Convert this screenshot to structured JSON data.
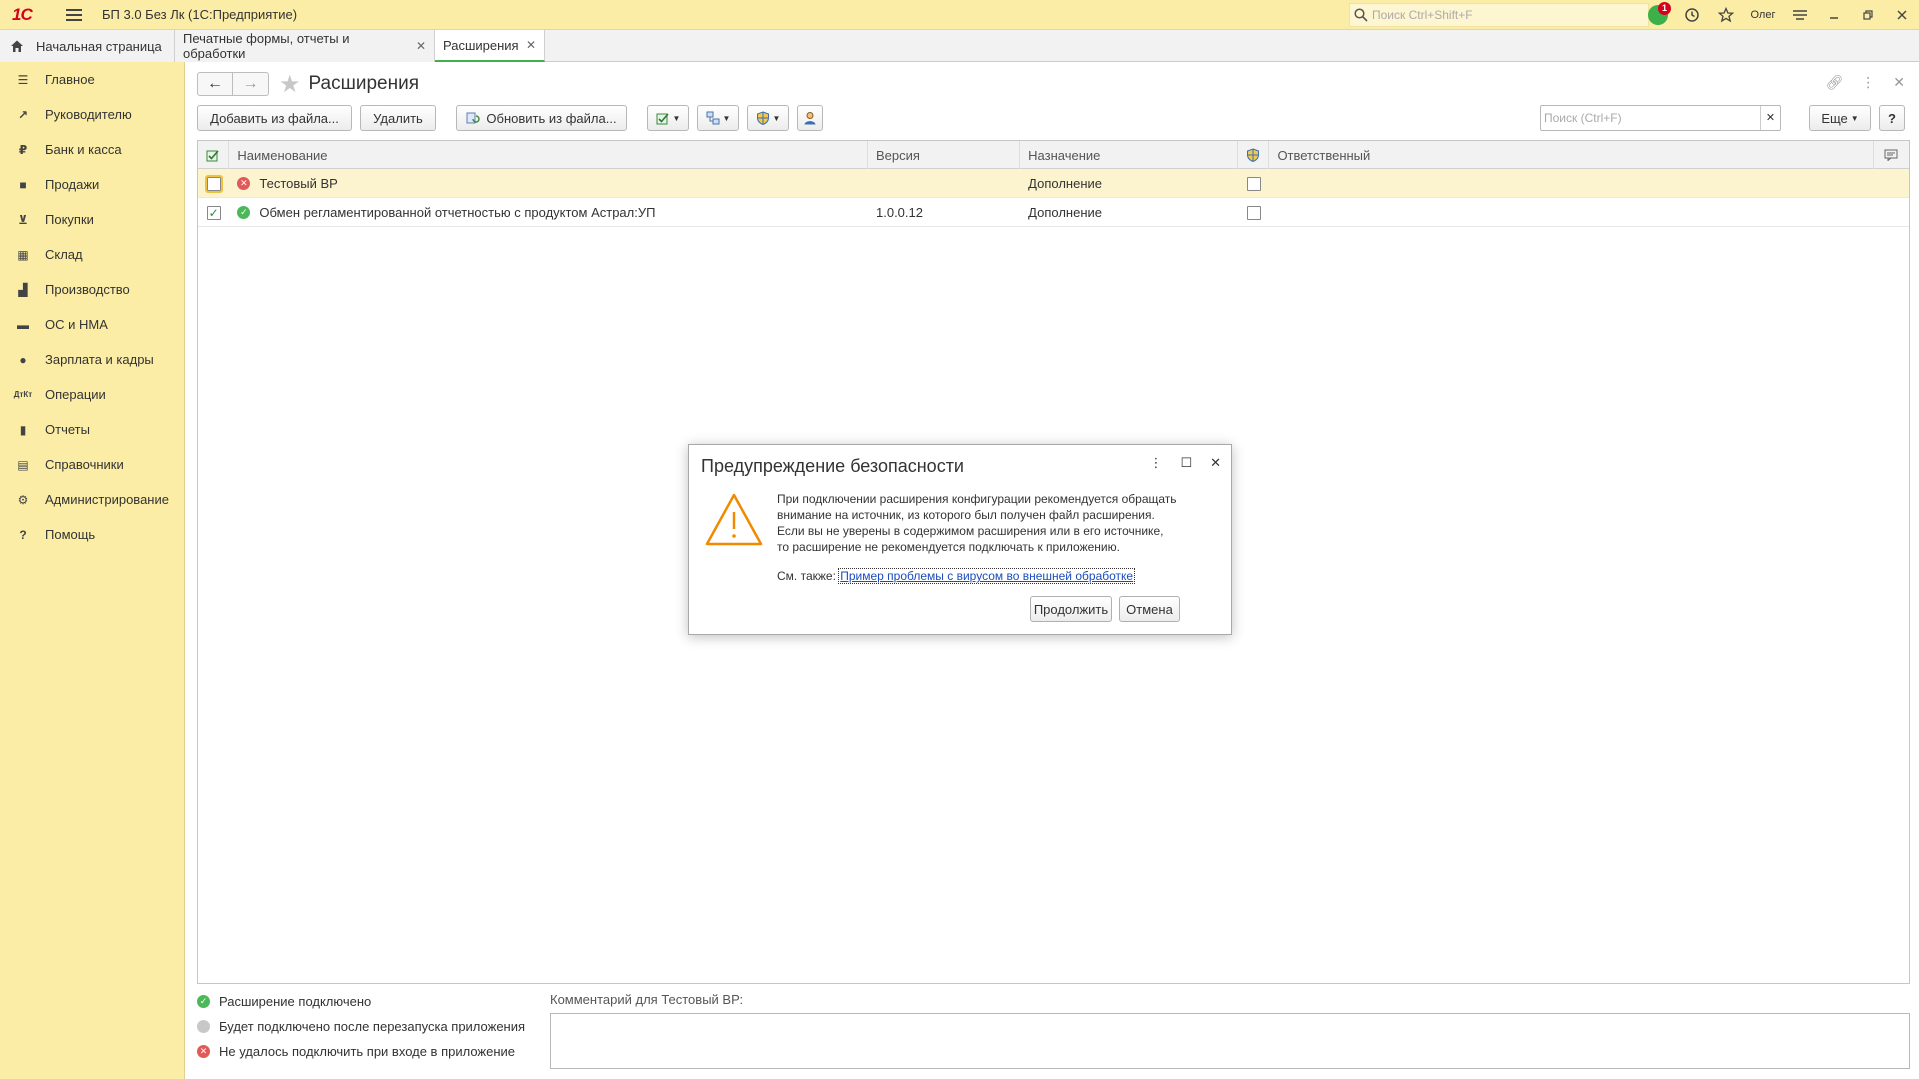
{
  "app": {
    "title": "БП 3.0 Без Лк  (1С:Предприятие)",
    "search_placeholder": "Поиск Ctrl+Shift+F",
    "notifications_count": "1",
    "user": "Олег"
  },
  "tabs": [
    {
      "label": "Начальная страница"
    },
    {
      "label": "Печатные формы, отчеты и обработки"
    },
    {
      "label": "Расширения"
    }
  ],
  "sidebar": {
    "items": [
      {
        "label": "Главное",
        "icon": "menu-icon"
      },
      {
        "label": "Руководителю",
        "icon": "trend-icon"
      },
      {
        "label": "Банк и касса",
        "icon": "ruble-icon"
      },
      {
        "label": "Продажи",
        "icon": "bag-icon"
      },
      {
        "label": "Покупки",
        "icon": "cart-icon"
      },
      {
        "label": "Склад",
        "icon": "grid-icon"
      },
      {
        "label": "Производство",
        "icon": "factory-icon"
      },
      {
        "label": "ОС и НМА",
        "icon": "truck-icon"
      },
      {
        "label": "Зарплата и кадры",
        "icon": "person-icon"
      },
      {
        "label": "Операции",
        "icon": "dt-kt-icon"
      },
      {
        "label": "Отчеты",
        "icon": "bar-chart-icon"
      },
      {
        "label": "Справочники",
        "icon": "book-icon"
      },
      {
        "label": "Администрирование",
        "icon": "gear-icon"
      },
      {
        "label": "Помощь",
        "icon": "question-icon"
      }
    ]
  },
  "page": {
    "title": "Расширения"
  },
  "toolbar": {
    "add_label": "Добавить из файла...",
    "delete_label": "Удалить",
    "update_label": "Обновить из файла...",
    "search_placeholder": "Поиск (Ctrl+F)",
    "more_label": "Еще",
    "help_label": "?"
  },
  "table": {
    "columns": [
      "Наименование",
      "Версия",
      "Назначение",
      "Ответственный"
    ],
    "rows": [
      {
        "checked": false,
        "status": "error",
        "name": "Тестовый ВР",
        "version": "",
        "purpose": "Дополнение",
        "safe_mode": false
      },
      {
        "checked": true,
        "status": "ok",
        "name": "Обмен регламентированной отчетностью с продуктом Астрал:УП",
        "version": "1.0.0.12",
        "purpose": "Дополнение",
        "safe_mode": false
      }
    ]
  },
  "legend": {
    "connected": "Расширение подключено",
    "after_restart": "Будет подключено после перезапуска приложения",
    "failed": "Не удалось подключить при входе в приложение"
  },
  "comment": {
    "label": "Комментарий для Тестовый ВР:"
  },
  "dialog": {
    "title": "Предупреждение безопасности",
    "text_line1": "При подключении расширения конфигурации рекомендуется обращать",
    "text_line2": "внимание на источник, из которого был получен файл расширения.",
    "text_line3": "Если вы не уверены в содержимом расширения или в его источнике,",
    "text_line4": "то расширение не рекомендуется подключать к приложению.",
    "see_also": "См. также:",
    "link": "Пример проблемы с вирусом во внешней обработке",
    "continue_label": "Продолжить",
    "cancel_label": "Отмена"
  },
  "colors": {
    "accent_yellow": "#fbeda5",
    "ok_green": "#4cb85a",
    "error_red": "#e05a5a",
    "warning_orange": "#f08a00"
  }
}
